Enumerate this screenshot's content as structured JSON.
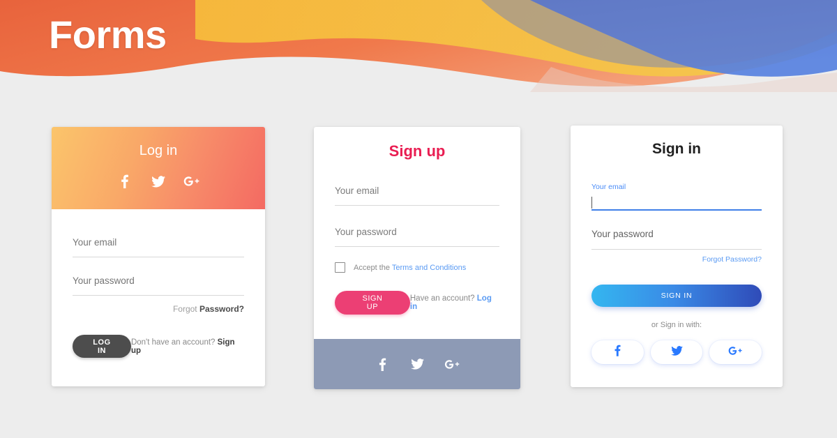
{
  "banner": {
    "title": "Forms",
    "colors": {
      "orange": "#ef7245",
      "yellow": "#f7c03f",
      "blue": "#4a72d6",
      "page_bg": "#ededed"
    }
  },
  "login_card": {
    "title": "Log in",
    "header_gradient_from": "#fbc56b",
    "header_gradient_to": "#f46a62",
    "social": [
      {
        "name": "facebook-icon",
        "label": "f"
      },
      {
        "name": "twitter-icon",
        "label": "t"
      },
      {
        "name": "google-plus-icon",
        "label": "G+"
      }
    ],
    "email": {
      "label": "Your email",
      "value": ""
    },
    "password": {
      "label": "Your password",
      "value": ""
    },
    "forgot_prefix": "Forgot ",
    "forgot_strong": "Password?",
    "submit_label": "LOG IN",
    "submit_color": "#4d4d4d",
    "footer_prefix": "Don't have an account? ",
    "footer_strong": "Sign up"
  },
  "signup_card": {
    "title": "Sign up",
    "title_color": "#e91e52",
    "email": {
      "label": "Your email",
      "value": ""
    },
    "password": {
      "label": "Your password",
      "value": ""
    },
    "terms_prefix": "Accept the ",
    "terms_link": "Terms and Conditions",
    "checkbox_checked": "false",
    "submit_label": "SIGN UP",
    "submit_color": "#ec3f74",
    "footer_prefix": "Have an account? ",
    "footer_link": "Log in",
    "footer_bg": "#8d9ab5",
    "social": [
      {
        "name": "facebook-icon",
        "label": "f"
      },
      {
        "name": "twitter-icon",
        "label": "t"
      },
      {
        "name": "google-plus-icon",
        "label": "G+"
      }
    ]
  },
  "signin_card": {
    "title": "Sign in",
    "email": {
      "label": "Your email",
      "value": "",
      "focused": "true",
      "accent": "#3f7fe8"
    },
    "password": {
      "label": "Your password",
      "value": ""
    },
    "forgot_link": "Forgot Password?",
    "submit_label": "SIGN IN",
    "submit_gradient_from": "#34b6f0",
    "submit_gradient_to": "#2f4bb8",
    "or_text": "or Sign in with:",
    "social": [
      {
        "name": "facebook-icon",
        "label": "f"
      },
      {
        "name": "twitter-icon",
        "label": "t"
      },
      {
        "name": "google-plus-icon",
        "label": "G+"
      }
    ]
  }
}
